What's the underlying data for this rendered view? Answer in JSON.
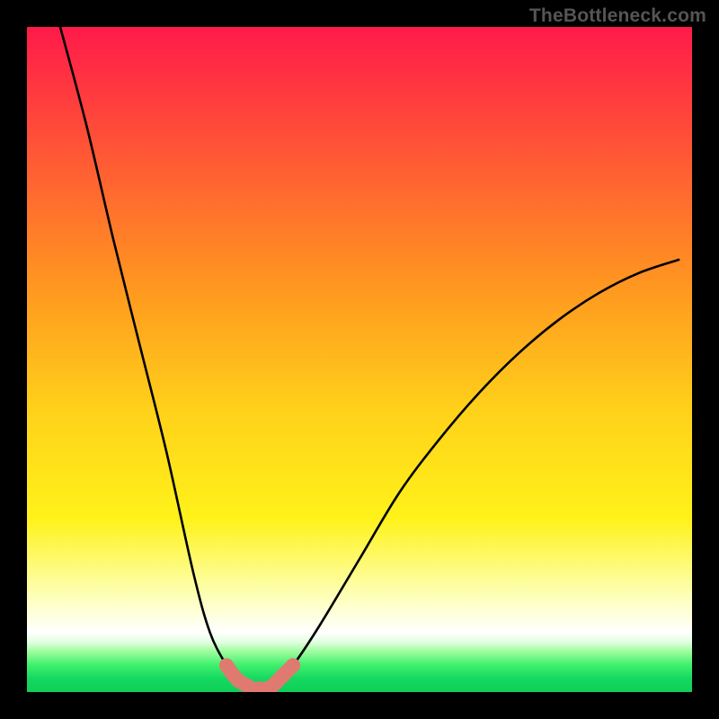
{
  "watermark": "TheBottleneck.com",
  "chart_data": {
    "type": "line",
    "title": "",
    "xlabel": "",
    "ylabel": "",
    "xlim": [
      0,
      100
    ],
    "ylim": [
      0,
      100
    ],
    "grid": false,
    "legend": false,
    "series": [
      {
        "name": "bottleneck-curve",
        "color": "#000000",
        "x": [
          5,
          9,
          13,
          17,
          21,
          25,
          27.5,
          30,
          31.5,
          33,
          34,
          35,
          36,
          37,
          38,
          40,
          44,
          50,
          56,
          62,
          68,
          74,
          80,
          86,
          92,
          98
        ],
        "y": [
          100,
          85,
          68,
          52,
          36,
          18,
          9,
          4,
          2,
          1,
          0.5,
          0.5,
          0.5,
          1,
          2,
          4,
          10,
          20,
          30,
          38,
          45,
          51,
          56,
          60,
          63,
          65
        ]
      },
      {
        "name": "highlight-band",
        "type": "scatter",
        "color": "#e07a70",
        "x": [
          30,
          31.5,
          33,
          34,
          35,
          36,
          37,
          38,
          40
        ],
        "y": [
          4,
          2,
          1,
          0.5,
          0.5,
          0.5,
          1,
          2,
          4
        ]
      }
    ],
    "gradient_stops": [
      {
        "pos": 0,
        "color": "#ff1a4a"
      },
      {
        "pos": 0.25,
        "color": "#ff6a2f"
      },
      {
        "pos": 0.58,
        "color": "#ffd21a"
      },
      {
        "pos": 0.85,
        "color": "#fdffb0"
      },
      {
        "pos": 0.92,
        "color": "#e0ffe0"
      },
      {
        "pos": 1.0,
        "color": "#0fcf58"
      }
    ]
  }
}
